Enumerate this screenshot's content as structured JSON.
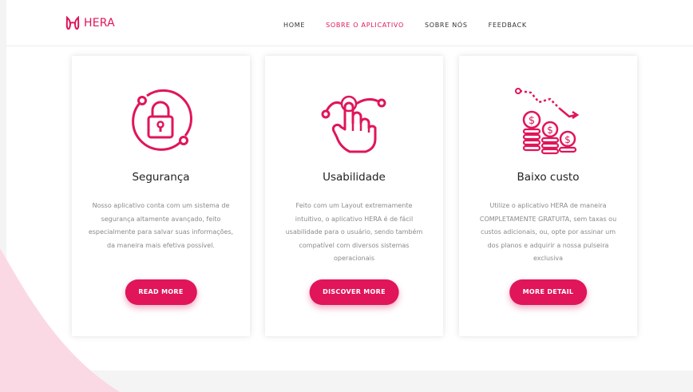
{
  "brand": {
    "name": "HERA",
    "accent": "#e0155a"
  },
  "nav": [
    {
      "label": "HOME"
    },
    {
      "label": "SOBRE O APLICATIVO",
      "active": true
    },
    {
      "label": "SOBRE NÓS"
    },
    {
      "label": "FEEDBACK"
    }
  ],
  "cards": [
    {
      "icon": "padlock-icon",
      "title": "Segurança",
      "text": "Nosso aplicativo conta com um sistema de segurança altamente avançado, feito especialmente para salvar suas informações, da maneira mais efetiva possível.",
      "button": "READ MORE"
    },
    {
      "icon": "touch-hand-icon",
      "title": "Usabilidade",
      "text": "Feito com um Layout extremamente intuitivo, o aplicativo HERA é de fácil usabilidade para o usuário, sendo também compatível com diversos sistemas operacionais",
      "button": "DISCOVER MORE"
    },
    {
      "icon": "coins-icon",
      "title": "Baixo custo",
      "text": "Utilize o aplicativo HERA de maneira COMPLETAMENTE GRATUITA, sem taxas ou custos adicionais, ou, opte por assinar um dos planos e adquirir a nossa pulseira exclusiva",
      "button": "MORE DETAIL"
    }
  ]
}
